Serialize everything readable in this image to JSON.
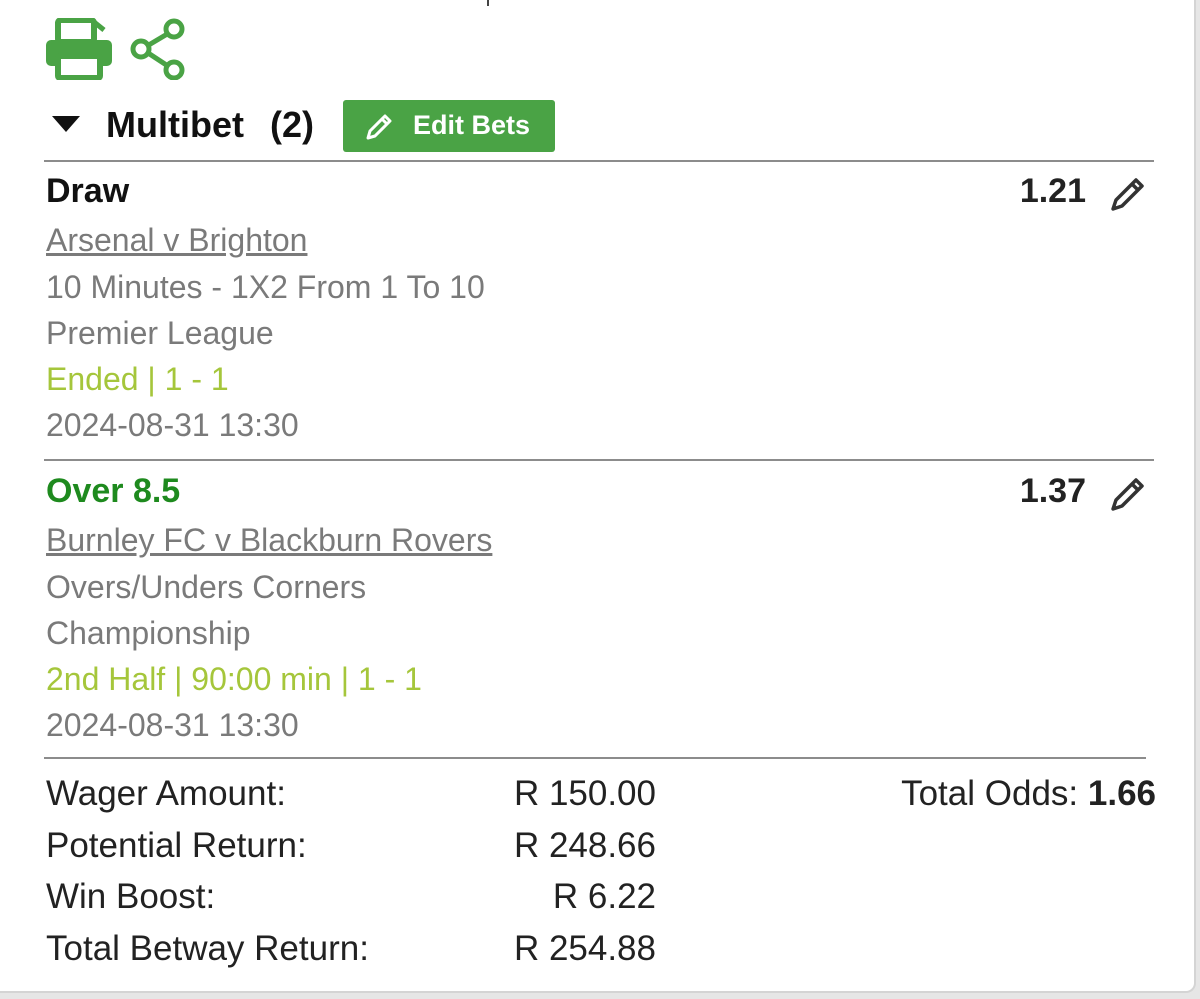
{
  "toolbar": {
    "print_icon": "printer-icon",
    "share_icon": "share-icon",
    "icon_color": "#4aa345"
  },
  "header": {
    "title": "Multibet",
    "count": "(2)",
    "edit_bets_label": "Edit Bets"
  },
  "selections": [
    {
      "pick": "Draw",
      "pick_color": "#111111",
      "odds": "1.21",
      "match": "Arsenal v Brighton",
      "market": "10 Minutes - 1X2 From 1 To 10",
      "league": "Premier League",
      "status": "Ended | 1 - 1",
      "datetime": "2024-08-31 13:30"
    },
    {
      "pick": "Over 8.5",
      "pick_color": "#1e8a1e",
      "odds": "1.37",
      "match": "Burnley FC v Blackburn Rovers",
      "market": "Overs/Unders Corners",
      "league": "Championship",
      "status": "2nd Half | 90:00 min | 1 - 1",
      "datetime": "2024-08-31 13:30"
    }
  ],
  "summary": {
    "wager_label": "Wager Amount:",
    "wager_value": "R 150.00",
    "potential_label": "Potential Return:",
    "potential_value": "R 248.66",
    "boost_label": "Win Boost:",
    "boost_value": "R 6.22",
    "total_return_label": "Total Betway Return:",
    "total_return_value": "R 254.88",
    "total_odds_label": "Total Odds:",
    "total_odds_value": "1.66"
  },
  "colors": {
    "brand_green": "#4aa345",
    "status_lime": "#a5c63b",
    "muted_text": "#7a7a7a"
  }
}
